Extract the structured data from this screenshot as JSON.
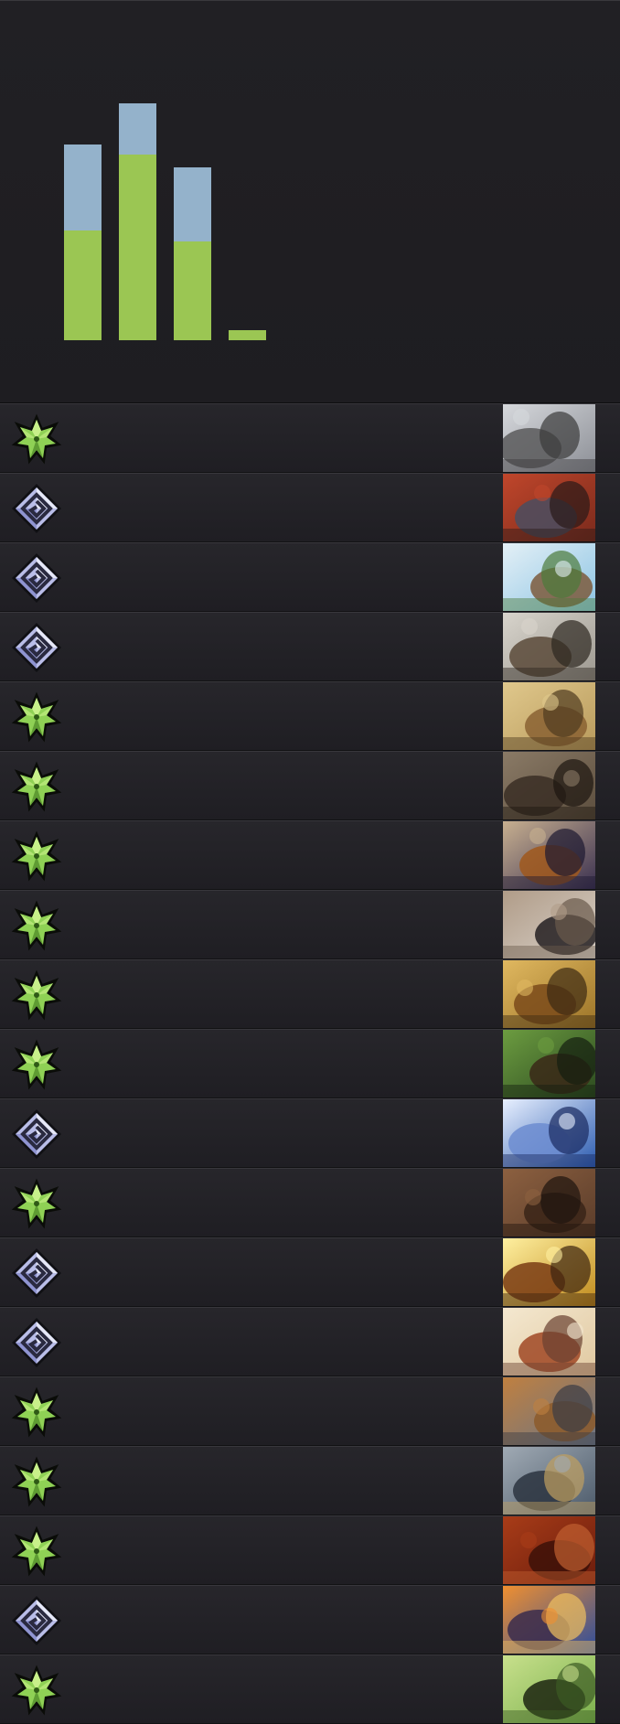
{
  "chart_data": {
    "type": "bar",
    "stacked": true,
    "categories": [
      "",
      "",
      "",
      ""
    ],
    "series": [
      {
        "values": [
          120,
          203,
          108,
          11
        ],
        "color": "#9bc653"
      },
      {
        "values": [
          94,
          56,
          81,
          0
        ],
        "color": "#94b2cb"
      }
    ],
    "ylim": [
      0,
      320
    ],
    "grid": false,
    "legend": false
  },
  "colors": {
    "background": "#1f1e22",
    "row_background": "#242328",
    "nature_green": "#9bc653",
    "order_blue": "#94b2cb"
  },
  "cards": [
    {
      "faction_icon": "nature-leaf-icon",
      "art": "grey-rat-on-rock-art"
    },
    {
      "faction_icon": "order-diamond-icon",
      "art": "hooded-warrior-red-art"
    },
    {
      "faction_icon": "order-diamond-icon",
      "art": "blacksmith-hammer-art"
    },
    {
      "faction_icon": "order-diamond-icon",
      "art": "armored-dwarf-art"
    },
    {
      "faction_icon": "nature-leaf-icon",
      "art": "brown-rabbit-art"
    },
    {
      "faction_icon": "nature-leaf-icon",
      "art": "sabretooth-beast-art"
    },
    {
      "faction_icon": "nature-leaf-icon",
      "art": "shaman-warrior-art"
    },
    {
      "faction_icon": "nature-leaf-icon",
      "art": "black-raven-art"
    },
    {
      "faction_icon": "nature-leaf-icon",
      "art": "autumn-squirrel-art"
    },
    {
      "faction_icon": "nature-leaf-icon",
      "art": "forest-ranger-art"
    },
    {
      "faction_icon": "order-diamond-icon",
      "art": "ice-knight-art"
    },
    {
      "faction_icon": "nature-leaf-icon",
      "art": "brown-bear-art"
    },
    {
      "faction_icon": "order-diamond-icon",
      "art": "golden-light-mage-art"
    },
    {
      "faction_icon": "order-diamond-icon",
      "art": "red-haired-archer-art"
    },
    {
      "faction_icon": "nature-leaf-icon",
      "art": "lion-warrior-art"
    },
    {
      "faction_icon": "nature-leaf-icon",
      "art": "wolf-pack-art"
    },
    {
      "faction_icon": "nature-leaf-icon",
      "art": "crimson-boar-art"
    },
    {
      "faction_icon": "order-diamond-icon",
      "art": "royal-guards-art"
    },
    {
      "faction_icon": "nature-leaf-icon",
      "art": "stag-silhouette-art"
    }
  ]
}
